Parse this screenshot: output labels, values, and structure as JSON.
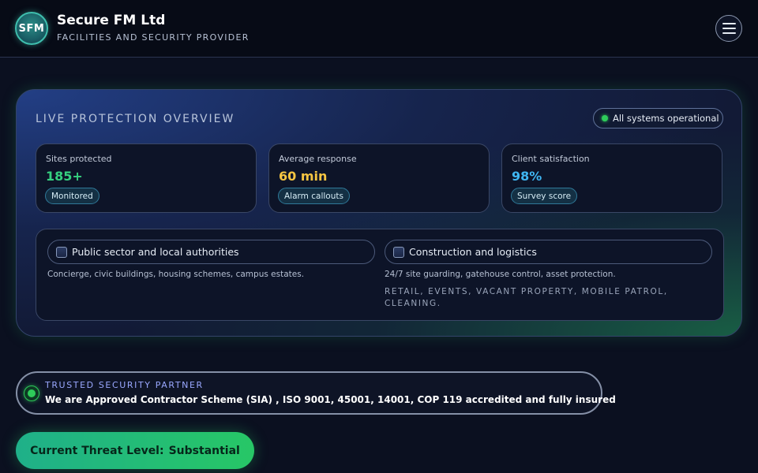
{
  "header": {
    "logo_text": "SFM",
    "title": "Secure FM Ltd",
    "subtitle": "FACILITIES AND SECURITY PROVIDER",
    "menu_icon": "hamburger-menu-icon"
  },
  "overview": {
    "title": "LIVE PROTECTION OVERVIEW",
    "status": "All systems operational",
    "status_color": "#2ecc5a",
    "stats": [
      {
        "label": "Sites protected",
        "value": "185+",
        "color": "#35d07f",
        "chip": "Monitored"
      },
      {
        "label": "Average response",
        "value": "60 min",
        "color": "#f5c542",
        "chip": "Alarm callouts"
      },
      {
        "label": "Client satisfaction",
        "value": "98%",
        "color": "#3fb6f2",
        "chip": "Survey score"
      }
    ],
    "sectors": [
      {
        "label": "Public sector and local authorities",
        "description": "Concierge, civic buildings, housing schemes, campus estates."
      },
      {
        "label": "Construction and logistics",
        "description": "24/7 site guarding, gatehouse control, asset protection."
      }
    ],
    "tags": "RETAIL, EVENTS, VACANT PROPERTY, MOBILE PATROL, CLEANING."
  },
  "partner": {
    "label": "TRUSTED SECURITY PARTNER",
    "text": "We are Approved Contractor Scheme (SIA) , ISO 9001, 45001, 14001, COP 119 accredited and fully insured"
  },
  "threat": {
    "label": "Current Threat Level:",
    "value": "Substantial"
  }
}
